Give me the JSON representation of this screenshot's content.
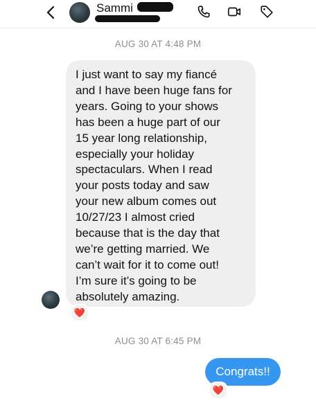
{
  "header": {
    "contact_name": "Sammi",
    "icons": [
      "back-arrow-icon",
      "phone-icon",
      "video-camera-icon",
      "tag-icon"
    ]
  },
  "thread": {
    "messages": [
      {
        "timestamp": "AUG 30 AT 4:48 PM",
        "direction": "incoming",
        "text": "I just want to say my fiancé\nand I have been huge fans for\nyears. Going to your shows\nhas been a huge part of our\n15 year long relationship,\nespecially your holiday\nspectaculars. When I read\nyour posts today and saw\nyour new album comes out\n10/27/23 I almost cried\nbecause that is the day that\nwe’re getting married. We\ncan’t wait for it to come out!\nI’m sure it’s going to be\nabsolutely amazing.",
        "reaction": "❤️"
      },
      {
        "timestamp": "AUG 30 AT 6:45 PM",
        "direction": "outgoing",
        "text": "Congrats!!",
        "reaction": "❤️"
      }
    ]
  },
  "colors": {
    "outgoing_bubble": "#3797f0",
    "incoming_bubble": "#efefef",
    "timestamp_text": "#8e8e8e"
  }
}
